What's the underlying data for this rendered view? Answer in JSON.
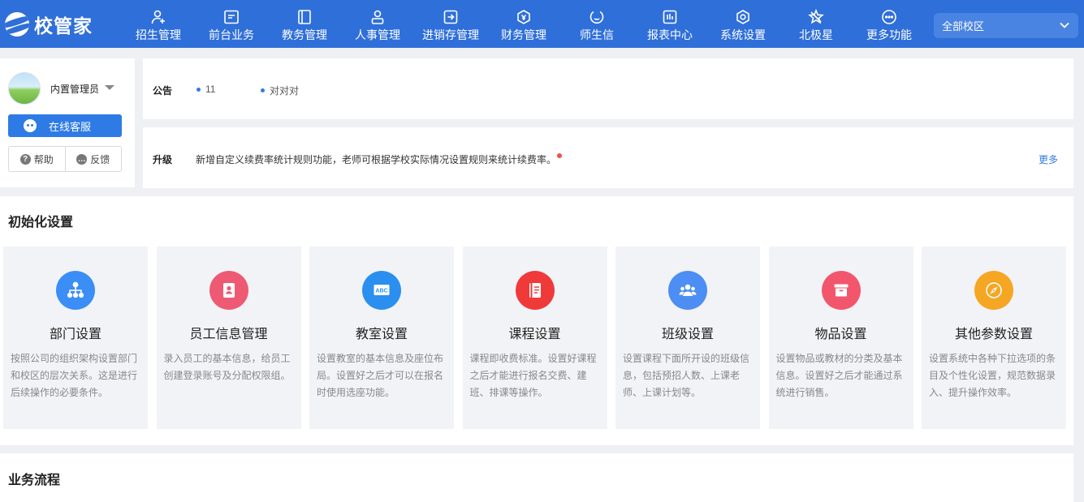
{
  "app": {
    "logo_text": "校管家"
  },
  "nav": [
    {
      "label": "招生管理",
      "icon": "add-user-icon"
    },
    {
      "label": "前台业务",
      "icon": "desk-icon"
    },
    {
      "label": "教务管理",
      "icon": "book-icon"
    },
    {
      "label": "人事管理",
      "icon": "person-icon"
    },
    {
      "label": "进销存管理",
      "icon": "inventory-icon"
    },
    {
      "label": "财务管理",
      "icon": "finance-icon"
    },
    {
      "label": "师生信",
      "icon": "message-icon"
    },
    {
      "label": "报表中心",
      "icon": "report-icon"
    },
    {
      "label": "系统设置",
      "icon": "settings-icon"
    },
    {
      "label": "北极星",
      "icon": "star-icon"
    },
    {
      "label": "更多功能",
      "icon": "more-icon"
    }
  ],
  "campus_select": {
    "value": "全部校区"
  },
  "user": {
    "name": "内置管理员",
    "online_service": "在线客服",
    "help": "帮助",
    "feedback": "反馈"
  },
  "notice": {
    "label": "公告",
    "items": [
      "11",
      "对对对"
    ]
  },
  "upgrade": {
    "label": "升级",
    "text": "新增自定义续费率统计规则功能，老师可根据学校实际情况设置规则来统计续费率。",
    "more": "更多"
  },
  "init_settings": {
    "title": "初始化设置",
    "cards": [
      {
        "title": "部门设置",
        "desc": "按照公司的组织架构设置部门和校区的层次关系。这是进行后续操作的必要条件。",
        "icon": "org-tree-icon",
        "color": "#3a8ef6"
      },
      {
        "title": "员工信息管理",
        "desc": "录入员工的基本信息，给员工创建登录账号及分配权限组。",
        "icon": "staff-card-icon",
        "color": "#ee5a73"
      },
      {
        "title": "教室设置",
        "desc": "设置教室的基本信息及座位布局。设置好之后才可以在报名时使用选座功能。",
        "icon": "classroom-board-icon",
        "color": "#2b8ff0"
      },
      {
        "title": "课程设置",
        "desc": "课程即收费标准。设置好课程之后才能进行报名交费、建班、排课等操作。",
        "icon": "course-book-icon",
        "color": "#f03a3a"
      },
      {
        "title": "班级设置",
        "desc": "设置课程下面所开设的班级信息，包括预招人数、上课老师、上课计划等。",
        "icon": "class-group-icon",
        "color": "#4d8ef5"
      },
      {
        "title": "物品设置",
        "desc": "设置物品或教材的分类及基本信息。设置好之后才能通过系统进行销售。",
        "icon": "goods-box-icon",
        "color": "#f2566d"
      },
      {
        "title": "其他参数设置",
        "desc": "设置系统中各种下拉选项的条目及个性化设置，规范数据录入、提升操作效率。",
        "icon": "compass-icon",
        "color": "#f5a623"
      }
    ]
  },
  "business_process": {
    "title": "业务流程"
  }
}
